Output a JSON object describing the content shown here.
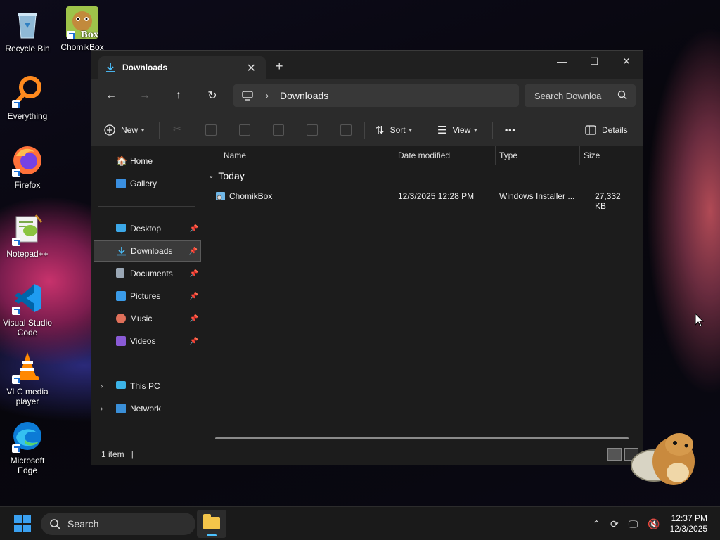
{
  "desktop": {
    "icons": [
      {
        "label": "Recycle Bin"
      },
      {
        "label": "ChomikBox",
        "badge": "Box"
      },
      {
        "label": "Everything"
      },
      {
        "label": "Firefox"
      },
      {
        "label": "Notepad++"
      },
      {
        "label": "Visual Studio Code"
      },
      {
        "label": "VLC media player"
      },
      {
        "label": "Microsoft Edge"
      }
    ]
  },
  "window": {
    "tab_title": "Downloads",
    "tab_close": "✕",
    "new_tab": "+",
    "controls": {
      "minimize": "—",
      "maximize": "☐",
      "close": "✕"
    }
  },
  "navbar": {
    "breadcrumb": "Downloads",
    "search_placeholder": "Search Downloa"
  },
  "toolbar": {
    "new_label": "New",
    "sort_label": "Sort",
    "view_label": "View",
    "more_label": "•••",
    "details_label": "Details"
  },
  "sidebar": {
    "items": [
      {
        "label": "Home"
      },
      {
        "label": "Gallery"
      },
      {
        "label": "Desktop"
      },
      {
        "label": "Downloads"
      },
      {
        "label": "Documents"
      },
      {
        "label": "Pictures"
      },
      {
        "label": "Music"
      },
      {
        "label": "Videos"
      },
      {
        "label": "This PC"
      },
      {
        "label": "Network"
      }
    ]
  },
  "columns": {
    "name": "Name",
    "date": "Date modified",
    "type": "Type",
    "size": "Size"
  },
  "group_label": "Today",
  "files": [
    {
      "name": "ChomikBox",
      "date": "12/3/2025 12:28 PM",
      "type": "Windows Installer ...",
      "size": "27,332 KB"
    }
  ],
  "status": {
    "count": "1 item",
    "cursor": "|"
  },
  "taskbar": {
    "search_label": "Search",
    "time": "12:37 PM",
    "date": "12/3/2025"
  },
  "colors": {
    "accent": "#4cc2ff",
    "window_bg": "#1c1c1c",
    "toolbar_bg": "#2b2b2b",
    "folder": "#f4c54a"
  }
}
